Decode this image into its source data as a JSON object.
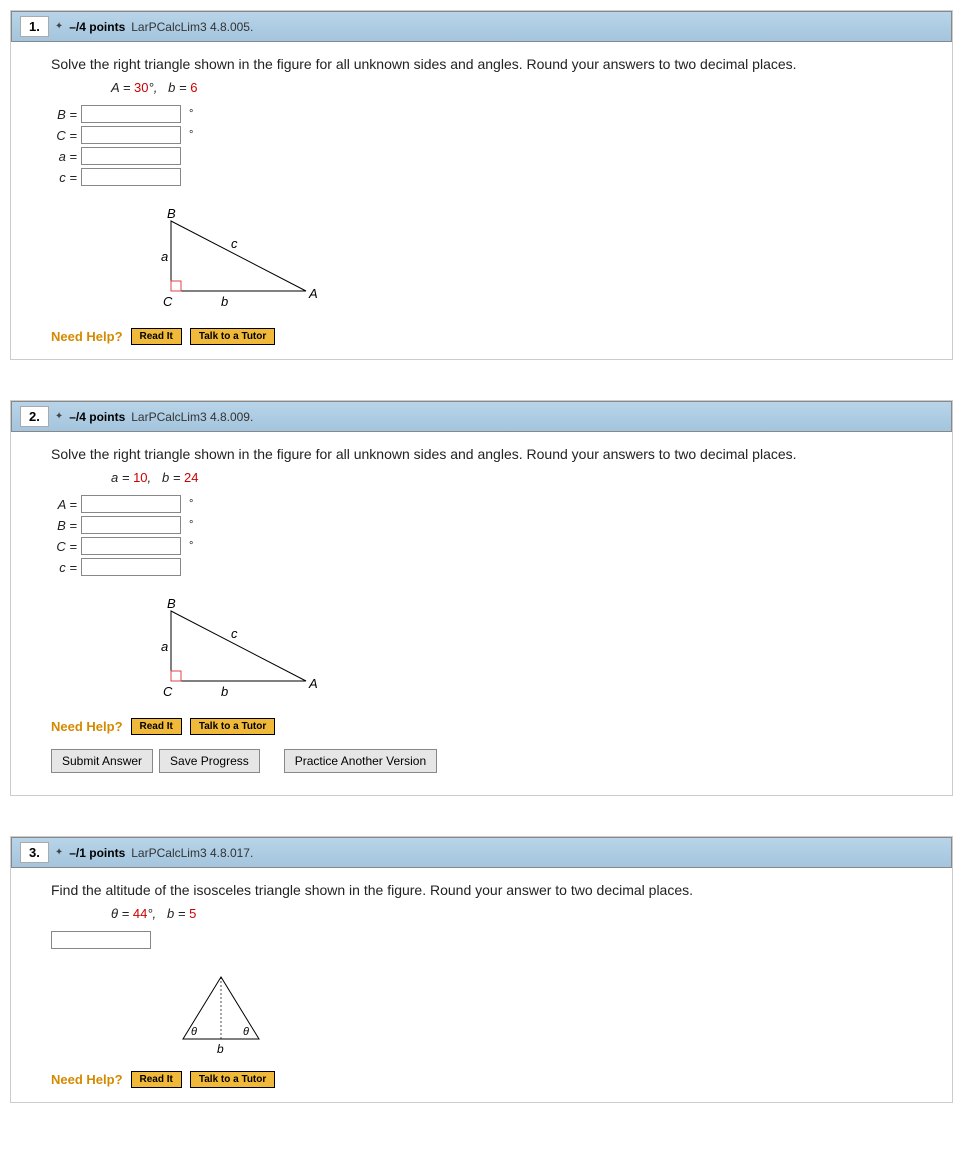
{
  "questions": [
    {
      "number": "1.",
      "points": "–/4 points",
      "bookref": "LarPCalcLim3 4.8.005.",
      "prompt": "Solve the right triangle shown in the figure for all unknown sides and angles. Round your answers to two decimal places.",
      "given_html": "A = 30°,   b = 6",
      "given_A_label": "A",
      "given_A_val": "30",
      "given_b_label": "b",
      "given_b_val": "6",
      "rows": [
        {
          "var": "B =",
          "unit": "°"
        },
        {
          "var": "C =",
          "unit": "°"
        },
        {
          "var": "a =",
          "unit": ""
        },
        {
          "var": "c =",
          "unit": ""
        }
      ]
    },
    {
      "number": "2.",
      "points": "–/4 points",
      "bookref": "LarPCalcLim3 4.8.009.",
      "prompt": "Solve the right triangle shown in the figure for all unknown sides and angles. Round your answers to two decimal places.",
      "given_a_label": "a",
      "given_a_val": "10",
      "given_b_label": "b",
      "given_b_val": "24",
      "rows": [
        {
          "var": "A =",
          "unit": "°"
        },
        {
          "var": "B =",
          "unit": "°"
        },
        {
          "var": "C =",
          "unit": "°"
        },
        {
          "var": "c =",
          "unit": ""
        }
      ]
    },
    {
      "number": "3.",
      "points": "–/1 points",
      "bookref": "LarPCalcLim3 4.8.017.",
      "prompt": "Find the altitude of the isosceles triangle shown in the figure. Round your answer to two decimal places.",
      "given_theta_label": "θ",
      "given_theta_val": "44",
      "given_b_label": "b",
      "given_b_val": "5"
    }
  ],
  "labels": {
    "need_help": "Need Help?",
    "read_it": "Read It",
    "tutor": "Talk to a Tutor",
    "submit": "Submit Answer",
    "save": "Save Progress",
    "practice": "Practice Another Version"
  },
  "fig": {
    "B": "B",
    "C": "C",
    "A": "A",
    "a": "a",
    "b": "b",
    "c": "c",
    "theta": "θ"
  }
}
